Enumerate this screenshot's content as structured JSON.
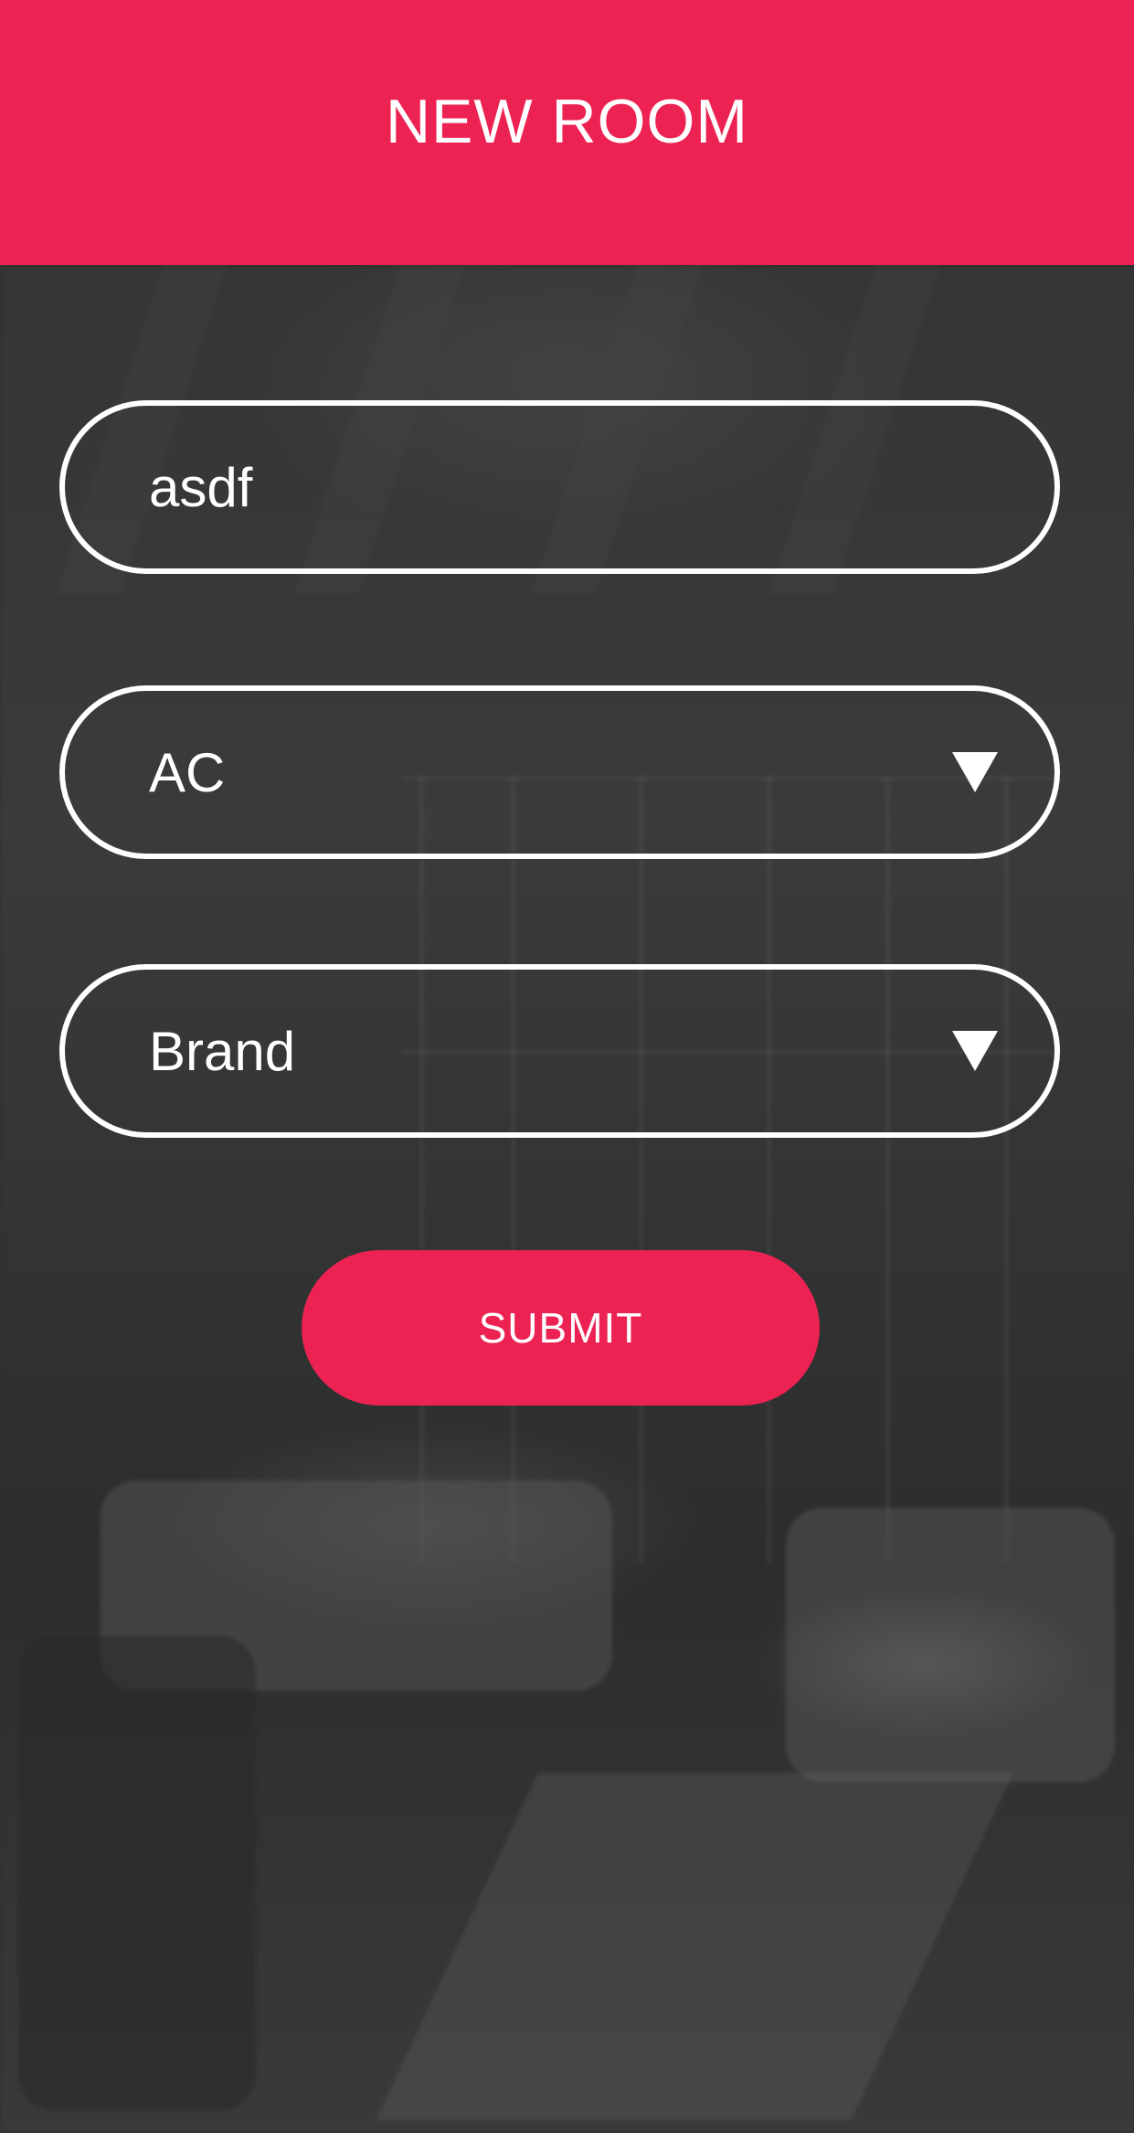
{
  "header": {
    "title": "NEW ROOM"
  },
  "form": {
    "room_name": {
      "value": "asdf"
    },
    "device_select": {
      "selected": "AC"
    },
    "brand_select": {
      "selected": "Brand"
    },
    "submit_label": "SUBMIT"
  },
  "colors": {
    "accent": "#ec2252",
    "background": "#2f3030",
    "text": "#ffffff"
  },
  "icons": {
    "dropdown": "caret-down-icon"
  }
}
